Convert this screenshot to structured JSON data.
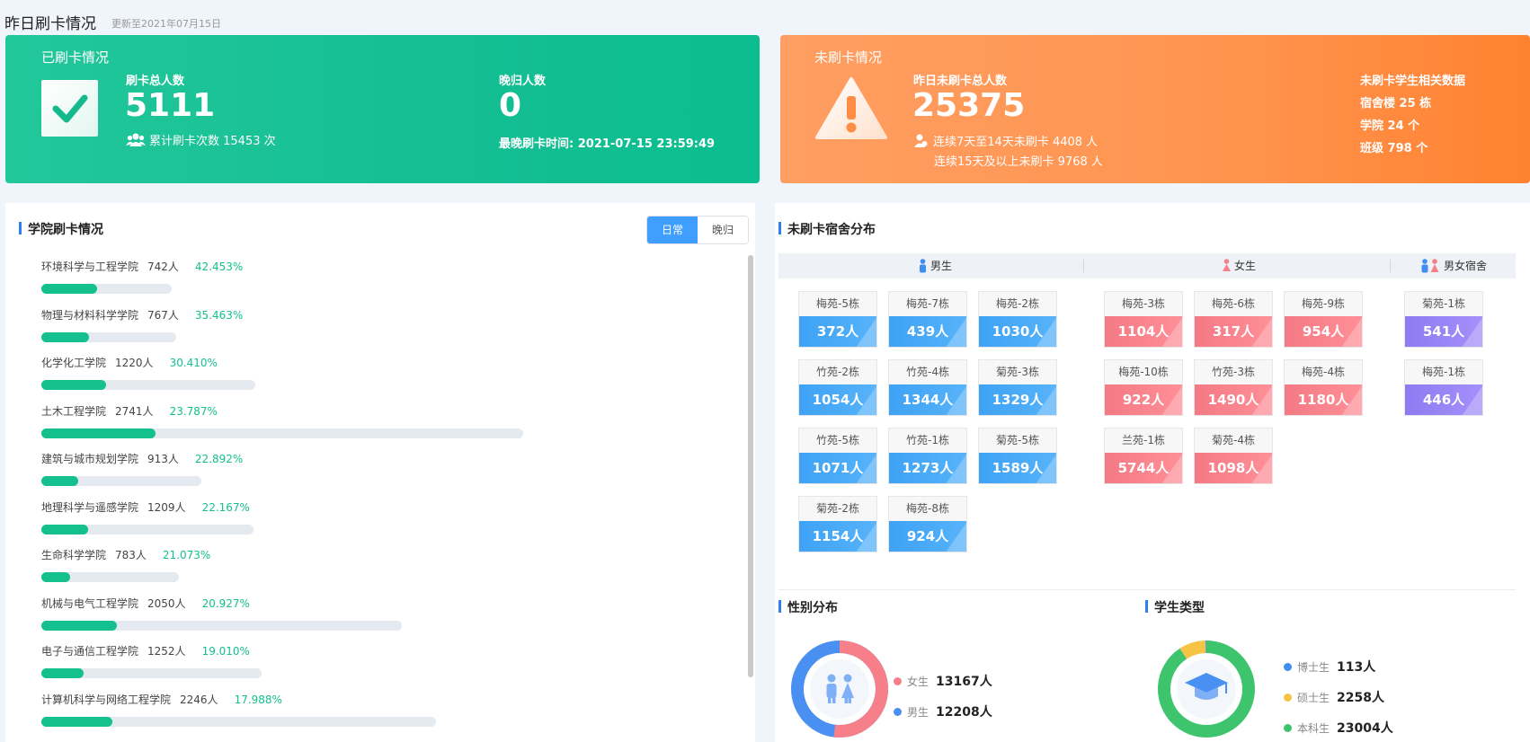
{
  "header": {
    "title": "昨日刷卡情况",
    "updated": "更新至2021年07月15日"
  },
  "swiped": {
    "title": "已刷卡情况",
    "total_label": "刷卡总人数",
    "total_value": "5111",
    "cumulative": "累计刷卡次数 15453 次",
    "late_label": "晚归人数",
    "late_value": "0",
    "latest_time": "最晚刷卡时间: 2021-07-15 23:59:49"
  },
  "not_swiped": {
    "title": "未刷卡情况",
    "total_label": "昨日未刷卡总人数",
    "total_value": "25375",
    "line1": "连续7天至14天未刷卡 4408 人",
    "line2": "连续15天及以上未刷卡 9768 人",
    "related_title": "未刷卡学生相关数据",
    "buildings": "宿舍楼 25 栋",
    "colleges": "学院 24 个",
    "classes": "班级 798 个"
  },
  "college_panel": {
    "title": "学院刷卡情况",
    "tabs": [
      "日常",
      "晚归"
    ],
    "rows": [
      {
        "name": "环境科学与工程学院",
        "count": "742人",
        "pct": "42.453%",
        "fill": 0.42453,
        "track": 145
      },
      {
        "name": "物理与材料科学学院",
        "count": "767人",
        "pct": "35.463%",
        "fill": 0.35463,
        "track": 150
      },
      {
        "name": "化学化工学院",
        "count": "1220人",
        "pct": "30.410%",
        "fill": 0.3041,
        "track": 238
      },
      {
        "name": "土木工程学院",
        "count": "2741人",
        "pct": "23.787%",
        "fill": 0.23787,
        "track": 536
      },
      {
        "name": "建筑与城市规划学院",
        "count": "913人",
        "pct": "22.892%",
        "fill": 0.22892,
        "track": 178
      },
      {
        "name": "地理科学与遥感学院",
        "count": "1209人",
        "pct": "22.167%",
        "fill": 0.22167,
        "track": 236
      },
      {
        "name": "生命科学学院",
        "count": "783人",
        "pct": "21.073%",
        "fill": 0.21073,
        "track": 153
      },
      {
        "name": "机械与电气工程学院",
        "count": "2050人",
        "pct": "20.927%",
        "fill": 0.20927,
        "track": 401
      },
      {
        "name": "电子与通信工程学院",
        "count": "1252人",
        "pct": "19.010%",
        "fill": 0.1901,
        "track": 245
      },
      {
        "name": "计算机科学与网络工程学院",
        "count": "2246人",
        "pct": "17.988%",
        "fill": 0.17988,
        "track": 439
      }
    ]
  },
  "dorm_panel": {
    "title": "未刷卡宿舍分布",
    "male_label": "男生",
    "female_label": "女生",
    "mixed_label": "男女宿舍",
    "male": [
      {
        "name": "梅苑-5栋",
        "count": "372人"
      },
      {
        "name": "梅苑-7栋",
        "count": "439人"
      },
      {
        "name": "梅苑-2栋",
        "count": "1030人"
      },
      {
        "name": "竹苑-2栋",
        "count": "1054人"
      },
      {
        "name": "竹苑-4栋",
        "count": "1344人"
      },
      {
        "name": "菊苑-3栋",
        "count": "1329人"
      },
      {
        "name": "竹苑-5栋",
        "count": "1071人"
      },
      {
        "name": "竹苑-1栋",
        "count": "1273人"
      },
      {
        "name": "菊苑-5栋",
        "count": "1589人"
      },
      {
        "name": "菊苑-2栋",
        "count": "1154人"
      },
      {
        "name": "梅苑-8栋",
        "count": "924人"
      }
    ],
    "female": [
      {
        "name": "梅苑-3栋",
        "count": "1104人"
      },
      {
        "name": "梅苑-6栋",
        "count": "317人"
      },
      {
        "name": "梅苑-9栋",
        "count": "954人"
      },
      {
        "name": "梅苑-10栋",
        "count": "922人"
      },
      {
        "name": "竹苑-3栋",
        "count": "1490人"
      },
      {
        "name": "梅苑-4栋",
        "count": "1180人"
      },
      {
        "name": "兰苑-1栋",
        "count": "5744人"
      },
      {
        "name": "菊苑-4栋",
        "count": "1098人"
      }
    ],
    "mixed": [
      {
        "name": "菊苑-1栋",
        "count": "541人"
      },
      {
        "name": "梅苑-1栋",
        "count": "446人"
      }
    ]
  },
  "gender": {
    "title": "性别分布",
    "items": [
      {
        "label": "女生",
        "value": "13167人",
        "num": 13167,
        "color": "#f67f89"
      },
      {
        "label": "男生",
        "value": "12208人",
        "num": 12208,
        "color": "#4a8ff2"
      }
    ]
  },
  "student_type": {
    "title": "学生类型",
    "items": [
      {
        "label": "博士生",
        "value": "113人",
        "num": 113,
        "color": "#3d8ef0"
      },
      {
        "label": "硕士生",
        "value": "2258人",
        "num": 2258,
        "color": "#f6c445"
      },
      {
        "label": "本科生",
        "value": "23004人",
        "num": 23004,
        "color": "#3ec46d"
      }
    ]
  }
}
